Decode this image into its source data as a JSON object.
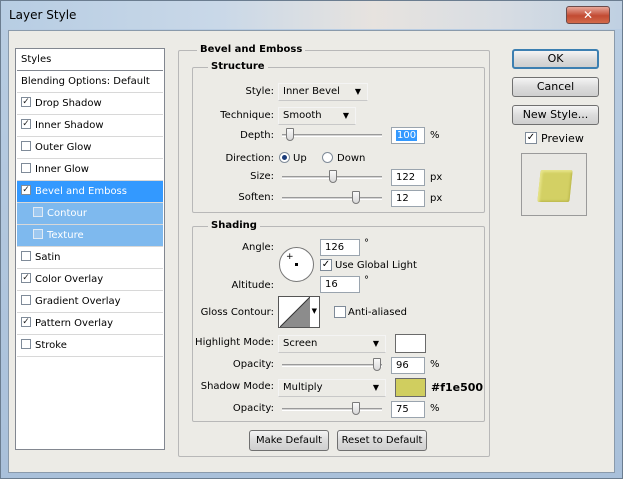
{
  "window": {
    "title": "Layer Style",
    "close_glyph": "✕"
  },
  "sidebar": {
    "header": "Styles",
    "items": [
      {
        "label": "Blending Options: Default",
        "checkbox": false,
        "checked": false
      },
      {
        "label": "Drop Shadow",
        "checkbox": true,
        "checked": true
      },
      {
        "label": "Inner Shadow",
        "checkbox": true,
        "checked": true
      },
      {
        "label": "Outer Glow",
        "checkbox": true,
        "checked": false
      },
      {
        "label": "Inner Glow",
        "checkbox": true,
        "checked": false
      },
      {
        "label": "Bevel and Emboss",
        "checkbox": true,
        "checked": true
      },
      {
        "label": "Contour",
        "checkbox": true,
        "checked": false
      },
      {
        "label": "Texture",
        "checkbox": true,
        "checked": false
      },
      {
        "label": "Satin",
        "checkbox": true,
        "checked": false
      },
      {
        "label": "Color Overlay",
        "checkbox": true,
        "checked": true
      },
      {
        "label": "Gradient Overlay",
        "checkbox": true,
        "checked": false
      },
      {
        "label": "Pattern Overlay",
        "checkbox": true,
        "checked": true
      },
      {
        "label": "Stroke",
        "checkbox": true,
        "checked": false
      }
    ]
  },
  "bevel": {
    "section_title": "Bevel and Emboss",
    "structure": {
      "title": "Structure",
      "style_label": "Style:",
      "style_value": "Inner Bevel",
      "technique_label": "Technique:",
      "technique_value": "Smooth",
      "depth_label": "Depth:",
      "depth_value": "100",
      "depth_unit": "%",
      "depth_level": 0.0,
      "direction_label": "Direction:",
      "direction_up": "Up",
      "direction_down": "Down",
      "size_label": "Size:",
      "size_value": "122",
      "size_unit": "px",
      "size_level": 0.5,
      "soften_label": "Soften:",
      "soften_value": "12",
      "soften_unit": "px",
      "soften_level": 0.73
    },
    "shading": {
      "title": "Shading",
      "angle_label": "Angle:",
      "angle_value": "126",
      "angle_unit": "°",
      "global_light_label": "Use Global Light",
      "altitude_label": "Altitude:",
      "altitude_value": "16",
      "altitude_unit": "°",
      "gloss_label": "Gloss Contour:",
      "anti_aliased_label": "Anti-aliased",
      "highlight_label": "Highlight Mode:",
      "highlight_value": "Screen",
      "opacity_label": "Opacity:",
      "highlight_opacity": "96",
      "highlight_opacity_level": 0.96,
      "opacity_unit": "%",
      "shadow_label": "Shadow Mode:",
      "shadow_value": "Multiply",
      "shadow_color_hex": "#f1e500",
      "shadow_opacity": "75",
      "shadow_opacity_level": 0.75,
      "highlight_color": "#ffffff",
      "shadow_color": "#d0ce5f"
    },
    "make_default": "Make Default",
    "reset_default": "Reset to Default"
  },
  "right": {
    "ok": "OK",
    "cancel": "Cancel",
    "new_style": "New Style...",
    "preview_label": "Preview",
    "preview_color": "#d3d064"
  }
}
